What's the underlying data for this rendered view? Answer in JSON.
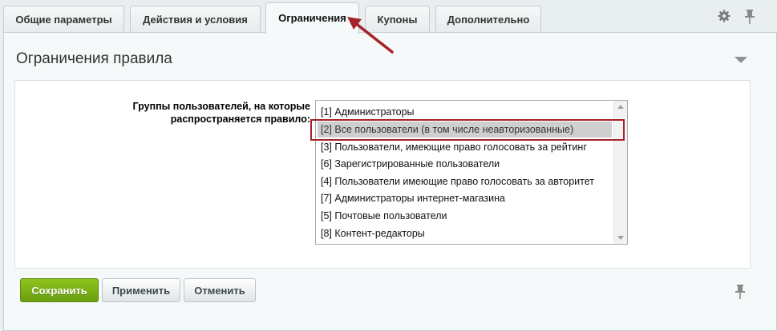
{
  "tabs": [
    {
      "label": "Общие параметры",
      "active": false
    },
    {
      "label": "Действия и условия",
      "active": false
    },
    {
      "label": "Ограничения",
      "active": true
    },
    {
      "label": "Купоны",
      "active": false
    },
    {
      "label": "Дополнительно",
      "active": false
    }
  ],
  "toolbar": {
    "settings_icon": "gear-icon",
    "pin_icon": "pin-icon"
  },
  "section": {
    "title": "Ограничения правила"
  },
  "field": {
    "label": "Группы пользователей, на которые распространяется правило:",
    "options": [
      "[1] Администраторы",
      "[2] Все пользователи (в том числе неавторизованные)",
      "[3] Пользователи, имеющие право голосовать за рейтинг",
      "[6] Зарегистрированные пользователи",
      "[4] Пользователи имеющие право голосовать за авторитет",
      "[7] Администраторы интернет-магазина",
      "[5] Почтовые пользователи",
      "[8] Контент-редакторы"
    ],
    "selected_index": 1
  },
  "buttons": {
    "save": "Сохранить",
    "apply": "Применить",
    "cancel": "Отменить"
  },
  "colors": {
    "accent_green": "#7cb518",
    "annotation_red": "#a42328"
  }
}
